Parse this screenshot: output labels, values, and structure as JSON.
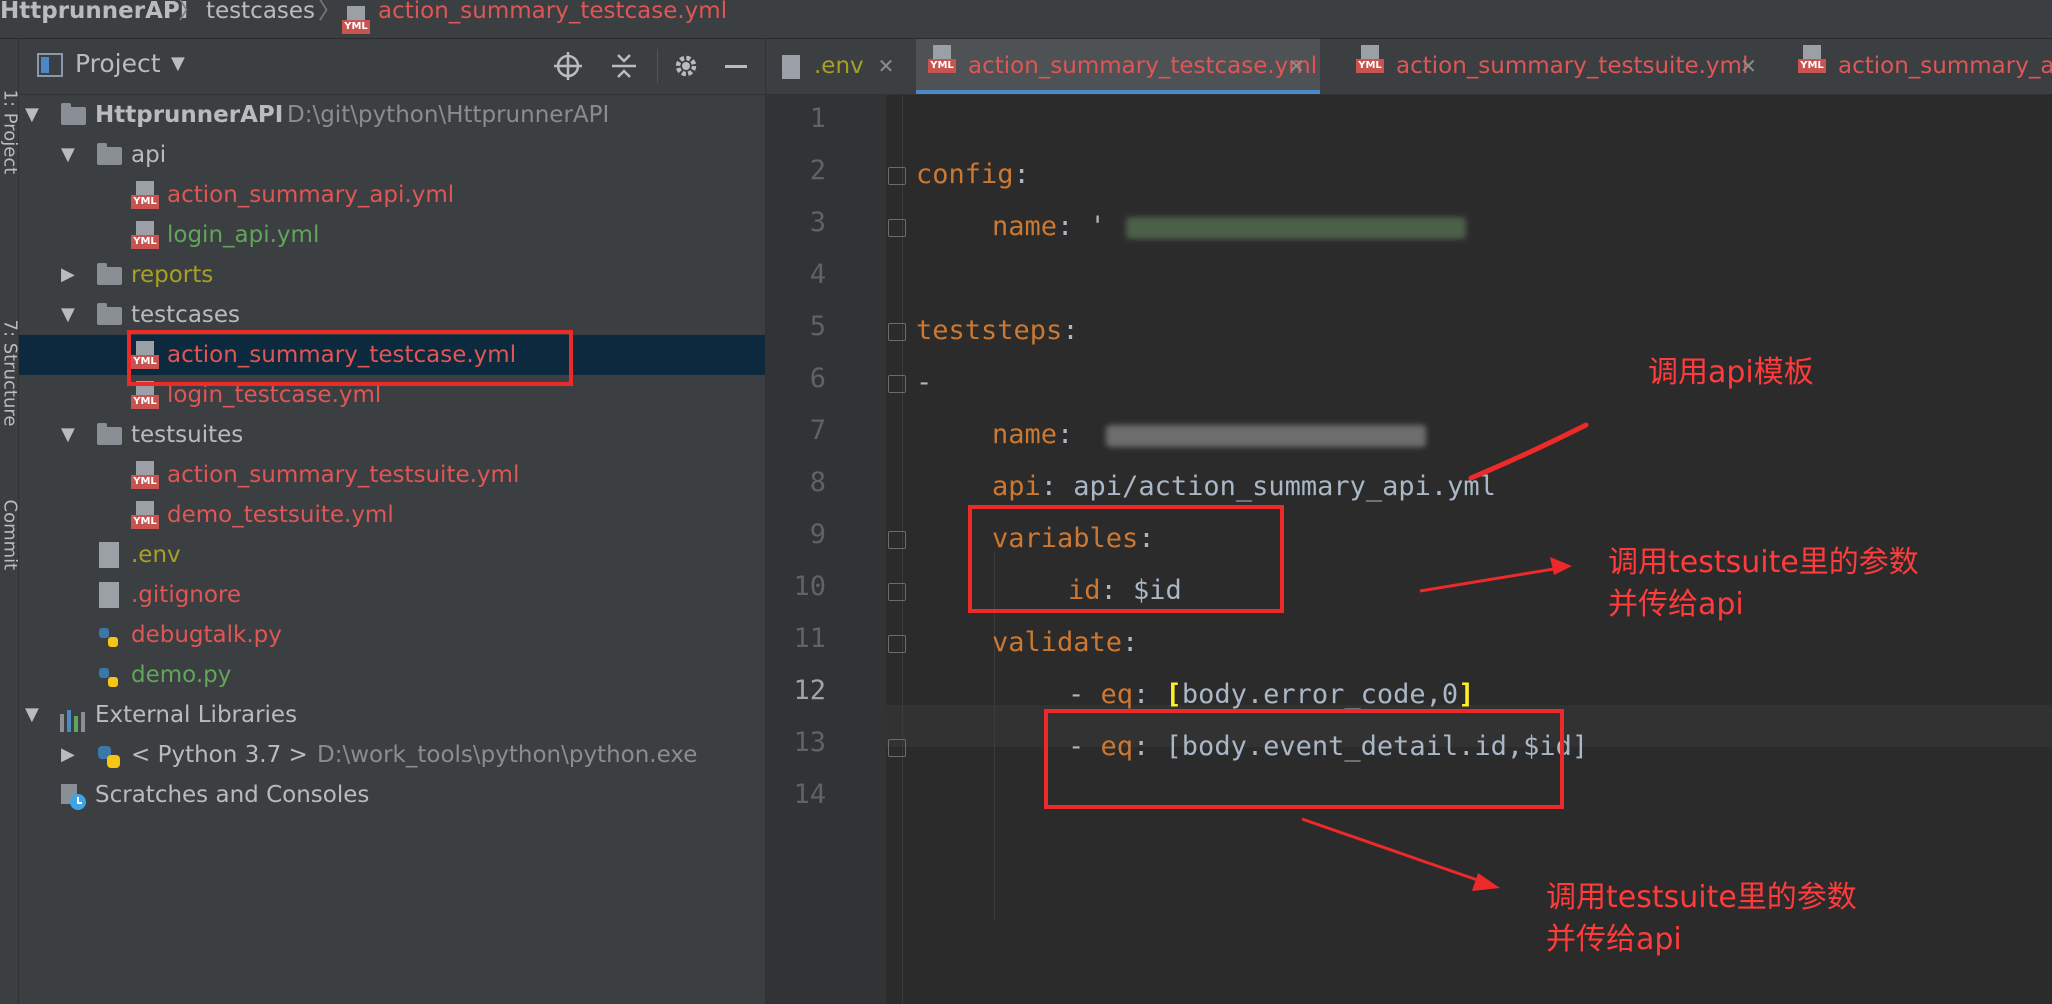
{
  "breadcrumb": {
    "project": "HttprunnerAPI",
    "folder": "testcases",
    "file": "action_summary_testcase.yml"
  },
  "toolstrip": {
    "project_label": "1: Project",
    "structure_label": "7: Structure",
    "commit_label": "Commit"
  },
  "project_panel": {
    "title": "Project",
    "tree": [
      {
        "label": "HttprunnerAPI",
        "path": "D:\\git\\python\\HttprunnerAPI"
      },
      {
        "label": "api"
      },
      {
        "label": "action_summary_api.yml"
      },
      {
        "label": "login_api.yml"
      },
      {
        "label": "reports"
      },
      {
        "label": "testcases"
      },
      {
        "label": "action_summary_testcase.yml"
      },
      {
        "label": "login_testcase.yml"
      },
      {
        "label": "testsuites"
      },
      {
        "label": "action_summary_testsuite.yml"
      },
      {
        "label": "demo_testsuite.yml"
      },
      {
        "label": ".env"
      },
      {
        "label": ".gitignore"
      },
      {
        "label": "debugtalk.py"
      },
      {
        "label": "demo.py"
      },
      {
        "label": "External Libraries"
      },
      {
        "label": "< Python 3.7 >",
        "path": "D:\\work_tools\\python\\python.exe"
      },
      {
        "label": "Scratches and Consoles"
      }
    ]
  },
  "tabs": [
    {
      "label": ".env"
    },
    {
      "label": "action_summary_testcase.yml"
    },
    {
      "label": "action_summary_testsuite.yml"
    },
    {
      "label": "action_summary_a"
    }
  ],
  "editor": {
    "line_numbers": [
      "1",
      "2",
      "3",
      "4",
      "5",
      "6",
      "7",
      "8",
      "9",
      "10",
      "11",
      "12",
      "13",
      "14"
    ],
    "code": {
      "config_key": "config",
      "name_key": "name",
      "teststeps_key": "teststeps",
      "dash": "-",
      "api_key": "api",
      "api_value": "api/action_summary_api.yml",
      "variables_key": "variables",
      "id_key": "id",
      "id_value": "$id",
      "validate_key": "validate",
      "eq1_value": "body.error_code,0",
      "eq2_value": "[body.event_detail.id,$id]"
    }
  },
  "annotations": {
    "api_template": "调用api模板",
    "testsuite_params_1_line1": "调用testsuite里的参数",
    "testsuite_params_1_line2": "并传给api",
    "testsuite_params_2_line1": "调用testsuite里的参数",
    "testsuite_params_2_line2": "并传给api"
  },
  "colors": {
    "accent_selection": "#0d293e",
    "annotation_red": "#ed2a2a",
    "yaml_key": "#cc7832",
    "file_modified_red": "#e05555",
    "file_added_green": "#62a55a",
    "ignored_yellow": "#a8a022"
  }
}
